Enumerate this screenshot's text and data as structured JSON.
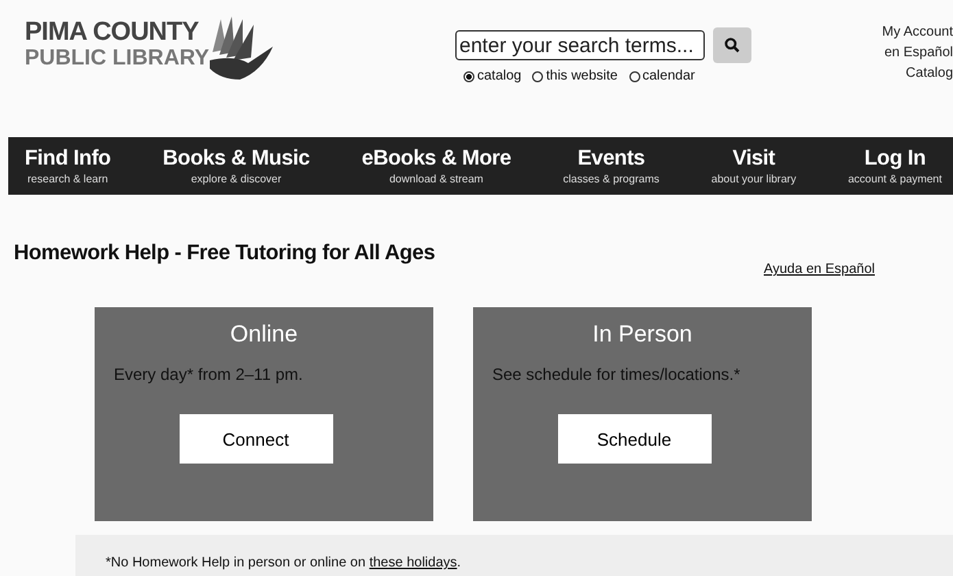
{
  "logo": {
    "line_1": "PIMA COUNTY",
    "line_2": "PUBLIC LIBRARY"
  },
  "search": {
    "placeholder": "enter your search terms...",
    "scopes": [
      {
        "label": "catalog",
        "selected": true
      },
      {
        "label": "this website",
        "selected": false
      },
      {
        "label": "calendar",
        "selected": false
      }
    ]
  },
  "top_links": [
    "My Account",
    "en Español",
    "Catalog"
  ],
  "nav": [
    {
      "label": "Find Info",
      "sub": "research & learn"
    },
    {
      "label": "Books & Music",
      "sub": "explore & discover"
    },
    {
      "label": "eBooks & More",
      "sub": "download & stream"
    },
    {
      "label": "Events",
      "sub": "classes & programs"
    },
    {
      "label": "Visit",
      "sub": "about your library"
    },
    {
      "label": "Log In",
      "sub": "account & payment"
    }
  ],
  "page_title": "Homework Help - Free Tutoring for All Ages",
  "language_link": "Ayuda en Español",
  "cards": [
    {
      "title": "Online",
      "text": "Every day* from 2–11 pm.",
      "button": "Connect"
    },
    {
      "title": "In Person",
      "text": "See schedule for times/locations.*",
      "button": "Schedule"
    }
  ],
  "note": {
    "before": "*No Homework Help in person or online on ",
    "link": "these holidays",
    "after": "."
  }
}
